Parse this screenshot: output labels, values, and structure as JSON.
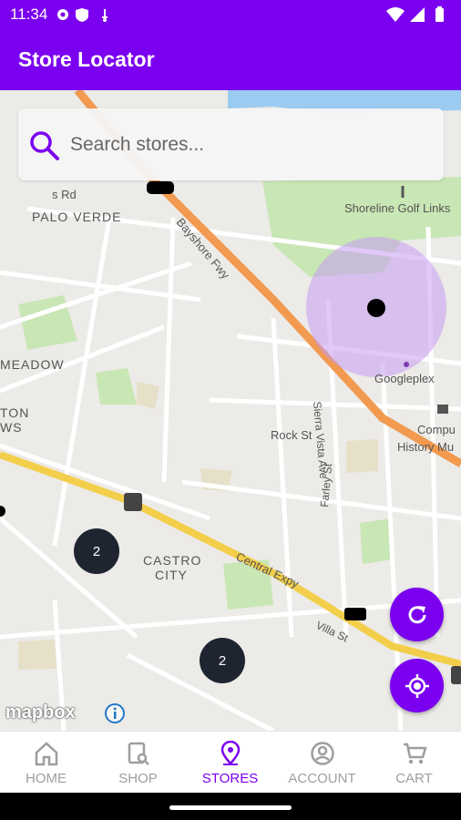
{
  "status_bar": {
    "time": "11:34",
    "icons": [
      "gear-icon",
      "shield-icon",
      "usb-icon",
      "wifi-icon",
      "signal-icon",
      "battery-icon"
    ]
  },
  "app_bar": {
    "title": "Store Locator"
  },
  "search": {
    "placeholder": "Search stores..."
  },
  "map": {
    "labels": {
      "palo_verde": "PALO VERDE",
      "rd": "s Rd",
      "bayshore": "Bayshore Fwy",
      "shoreline": "Shoreline Golf Links",
      "googleplex": "Googleplex",
      "meadow": "MEADOW",
      "ton": "TON",
      "ws": "WS",
      "rock_st": "Rock St",
      "sierra_vista": "Sierra Vista Ave",
      "farley": "Farley St",
      "computer_line1": "Compu",
      "computer_line2": "History Mu",
      "castro_line1": "CASTRO",
      "castro_line2": "CITY",
      "central_expy": "Central Expy",
      "villa_st": "Villa St"
    },
    "clusters": [
      {
        "count": "2"
      },
      {
        "count": "2"
      }
    ],
    "attribution": "mapbox"
  },
  "fabs": {
    "refresh": "refresh-icon",
    "locate": "my-location-icon"
  },
  "colors": {
    "primary": "#7B00F0",
    "cluster": "#1F2431",
    "map_bg": "#ECEBE8"
  },
  "nav": [
    {
      "label": "HOME",
      "icon": "home-icon"
    },
    {
      "label": "SHOP",
      "icon": "shop-search-icon"
    },
    {
      "label": "STORES",
      "icon": "location-pin-icon",
      "active": true
    },
    {
      "label": "ACCOUNT",
      "icon": "account-icon"
    },
    {
      "label": "CART",
      "icon": "cart-icon"
    }
  ]
}
